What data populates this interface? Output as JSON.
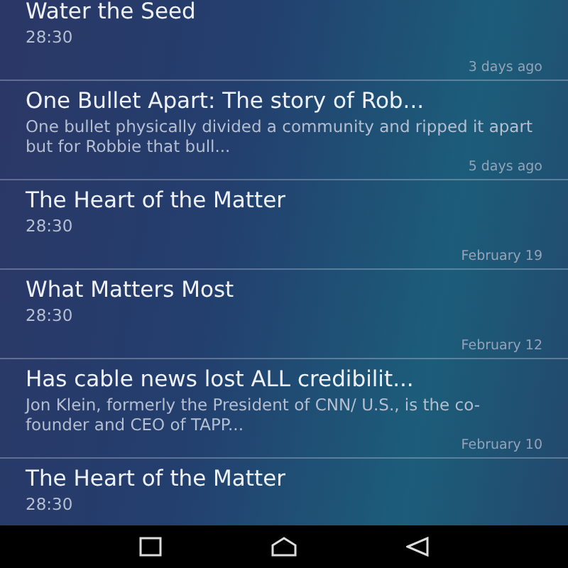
{
  "episodes": [
    {
      "title": "Water the Seed",
      "subtitle": "28:30",
      "date": "3 days ago"
    },
    {
      "title": "One Bullet Apart: The story of Rob...",
      "subtitle": "One bullet physically divided a community and ripped it apart but for Robbie that bull...",
      "date": "5 days ago"
    },
    {
      "title": "The Heart of the Matter",
      "subtitle": "28:30",
      "date": "February 19"
    },
    {
      "title": "What Matters Most",
      "subtitle": "28:30",
      "date": "February 12"
    },
    {
      "title": "Has cable news lost ALL credibilit...",
      "subtitle": "Jon Klein, formerly the President of CNN/ U.S.,  is the co-founder and CEO of TAPP...",
      "date": "February 10"
    },
    {
      "title": "The Heart of the Matter",
      "subtitle": "28:30"
    }
  ]
}
